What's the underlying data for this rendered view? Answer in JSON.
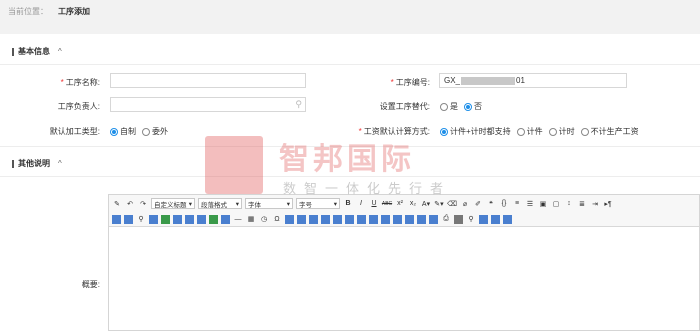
{
  "breadcrumb": {
    "label": "当前位置：",
    "current": "工序添加"
  },
  "basic": {
    "title": "基本信息",
    "name_label": "工序名称:",
    "owner_label": "工序负责人:",
    "type_label": "默认加工类型:",
    "code_label": "工序编号:",
    "code_prefix": "GX_",
    "code_suffix": "01",
    "alt_label": "设置工序替代:",
    "alt_options": [
      "是",
      "否"
    ],
    "alt_selected": "否",
    "type_options": [
      "自制",
      "委外"
    ],
    "type_selected": "自制",
    "calc_label": "工资默认计算方式:",
    "calc_options": [
      "计件+计时都支持",
      "计件",
      "计时",
      "不计生产工资"
    ],
    "calc_selected": "计件+计时都支持"
  },
  "other": {
    "title": "其他说明",
    "summary_label": "概要:",
    "editor": {
      "custom_title": "自定义标题",
      "paragraph": "段落格式",
      "font": "字体",
      "font_size": "字号",
      "bold": "B",
      "italic": "I",
      "underline": "U",
      "strike": "ABC"
    }
  },
  "watermark": {
    "text": "智邦国际",
    "sub": "数智一体化先行者"
  }
}
